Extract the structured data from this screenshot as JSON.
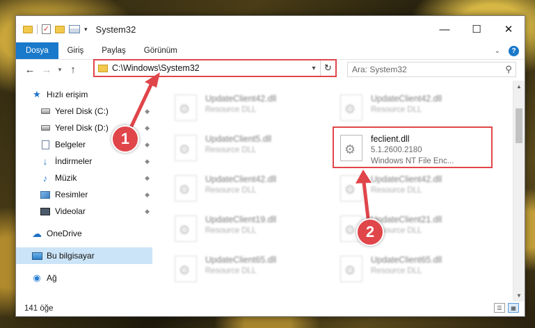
{
  "window": {
    "title": "System32"
  },
  "ribbon": {
    "tabs": [
      "Dosya",
      "Giriş",
      "Paylaş",
      "Görünüm"
    ],
    "help": "?"
  },
  "address": {
    "path": "C:\\Windows\\System32"
  },
  "search": {
    "placeholder": "Ara: System32"
  },
  "sidebar": {
    "items": [
      {
        "label": "Hızlı erişim"
      },
      {
        "label": "Yerel Disk (C:)"
      },
      {
        "label": "Yerel Disk (D:)"
      },
      {
        "label": "Belgeler"
      },
      {
        "label": "İndirmeler"
      },
      {
        "label": "Müzik"
      },
      {
        "label": "Resimler"
      },
      {
        "label": "Videolar"
      },
      {
        "label": "OneDrive"
      },
      {
        "label": "Bu bilgisayar"
      },
      {
        "label": "Ağ"
      }
    ]
  },
  "files": {
    "items": [
      {
        "name": "UpdateClient42.dll",
        "desc": "Resource DLL"
      },
      {
        "name": "UpdateClient42.dll",
        "desc": "Resource DLL"
      },
      {
        "name": "UpdateClient5.dll",
        "desc": "Resource DLL"
      },
      {
        "name": "UpdateClient42.dll",
        "desc": "Resource DLL"
      },
      {
        "name": "UpdateClient42.dll",
        "desc": "Resource DLL"
      },
      {
        "name": "UpdateClient19.dll",
        "desc": "Resource DLL"
      },
      {
        "name": "UpdateClient21.dll",
        "desc": "Resource DLL"
      },
      {
        "name": "UpdateClient65.dll",
        "desc": "Resource DLL"
      },
      {
        "name": "UpdateClient65.dll",
        "desc": "Resource DLL"
      }
    ],
    "target": {
      "name": "feclient.dll",
      "version": "5.1.2600.2180",
      "desc": "Windows NT File Enc..."
    }
  },
  "status": {
    "count": "141 öğe"
  },
  "callouts": {
    "one": "1",
    "two": "2"
  },
  "colors": {
    "accent": "#1979ca",
    "highlight": "#e0454a"
  }
}
